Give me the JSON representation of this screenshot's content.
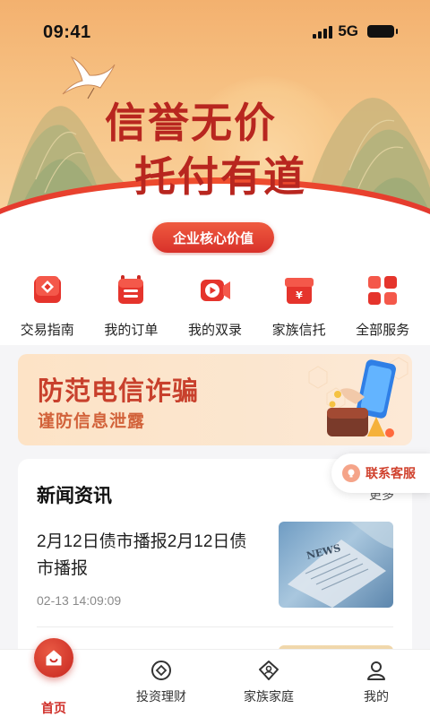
{
  "status_bar": {
    "time": "09:41",
    "network": "5G"
  },
  "hero": {
    "slogan_line1": "信誉无价",
    "slogan_line2": "托付有道",
    "core_values_button": "企业核心价值"
  },
  "quick_menu": [
    {
      "label": "交易指南",
      "icon": "guide-icon"
    },
    {
      "label": "我的订单",
      "icon": "order-icon"
    },
    {
      "label": "我的双录",
      "icon": "video-record-icon"
    },
    {
      "label": "家族信托",
      "icon": "trust-box-icon"
    },
    {
      "label": "全部服务",
      "icon": "all-services-icon"
    }
  ],
  "banner": {
    "title": "防范电信诈骗",
    "subtitle": "谨防信息泄露"
  },
  "news": {
    "title": "新闻资讯",
    "more": "更多",
    "items": [
      {
        "headline": "2月12日债市播报2月12日债市播报",
        "time": "02-13 14:09:09"
      }
    ]
  },
  "float_service": {
    "label": "联系客服"
  },
  "tab_bar": [
    {
      "label": "首页",
      "icon": "home-icon",
      "active": true
    },
    {
      "label": "投资理财",
      "icon": "invest-icon",
      "active": false
    },
    {
      "label": "家族家庭",
      "icon": "family-icon",
      "active": false
    },
    {
      "label": "我的",
      "icon": "profile-icon",
      "active": false
    }
  ],
  "colors": {
    "brand_red": "#d0302a",
    "hero_orange": "#f3b16f",
    "banner_bg": "#fde3c6"
  }
}
